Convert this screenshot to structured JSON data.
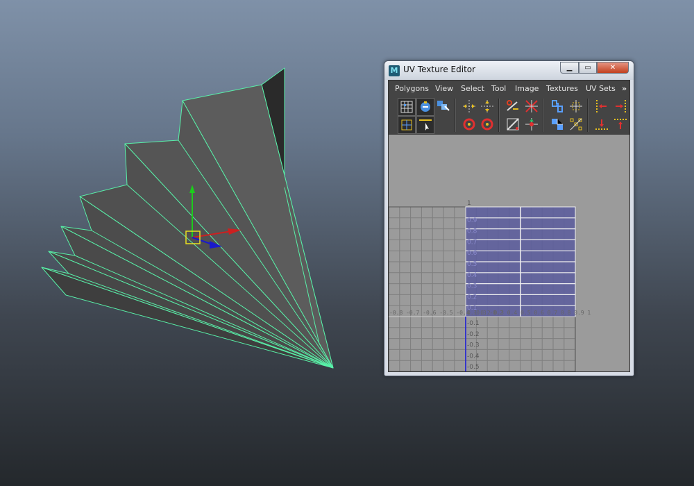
{
  "window": {
    "title": "UV Texture Editor",
    "app_icon": "maya-icon",
    "buttons": {
      "minimize": "▁",
      "maximize": "▭",
      "close": "✕"
    }
  },
  "menu": {
    "items": [
      "Polygons",
      "View",
      "Select",
      "Tool",
      "Image",
      "Textures",
      "UV Sets"
    ],
    "overflow": "»"
  },
  "toolbar": {
    "icons": [
      "uv-grid-icon",
      "uv-rotate-icon",
      "uv-select-move-icon",
      "uv-flip-u-icon",
      "uv-flip-v-icon",
      "uv-cut-icon",
      "uv-sew-icon",
      "uv-layout-icon",
      "uv-snap-icon",
      "uv-align-left-icon",
      "uv-align-right-icon",
      "uv-frame-icon",
      "uv-select-tool-icon",
      "uv-rotate-ccw-icon",
      "uv-rotate-cw-icon",
      "uv-unfold-icon",
      "uv-move-pivot-icon",
      "uv-normalize-icon",
      "uv-grid-snap-icon",
      "uv-align-bottom-icon",
      "uv-align-top-icon"
    ]
  },
  "uv_grid": {
    "v_labels": [
      "1",
      "0.9",
      "0.8",
      "0.7",
      "0.6",
      "0.5",
      "0.4",
      "0.3",
      "0.2",
      "0.1"
    ],
    "u_labels_neg": [
      "-0.1",
      "-0.2",
      "-0.3",
      "-0.4",
      "-0.5"
    ],
    "u_axis_text": "-0.8 -0.7 -0.6 -0.5 -0.4 -0.3 -0.2",
    "u_axis_text_pos": "0.1 0.2 0.3 0.4 0.5 0.6 0.7 0.8 0.9 1",
    "highlight_color": "#5a5c9e",
    "axis_color": "#1a1ae0"
  },
  "scene": {
    "wire_color": "#58f0a8",
    "manipulator": {
      "y_axis_color": "#1ccc1c",
      "x_axis_color": "#cc2020",
      "z_axis_color": "#1a1acc",
      "pivot_color": "#e8e020"
    }
  }
}
